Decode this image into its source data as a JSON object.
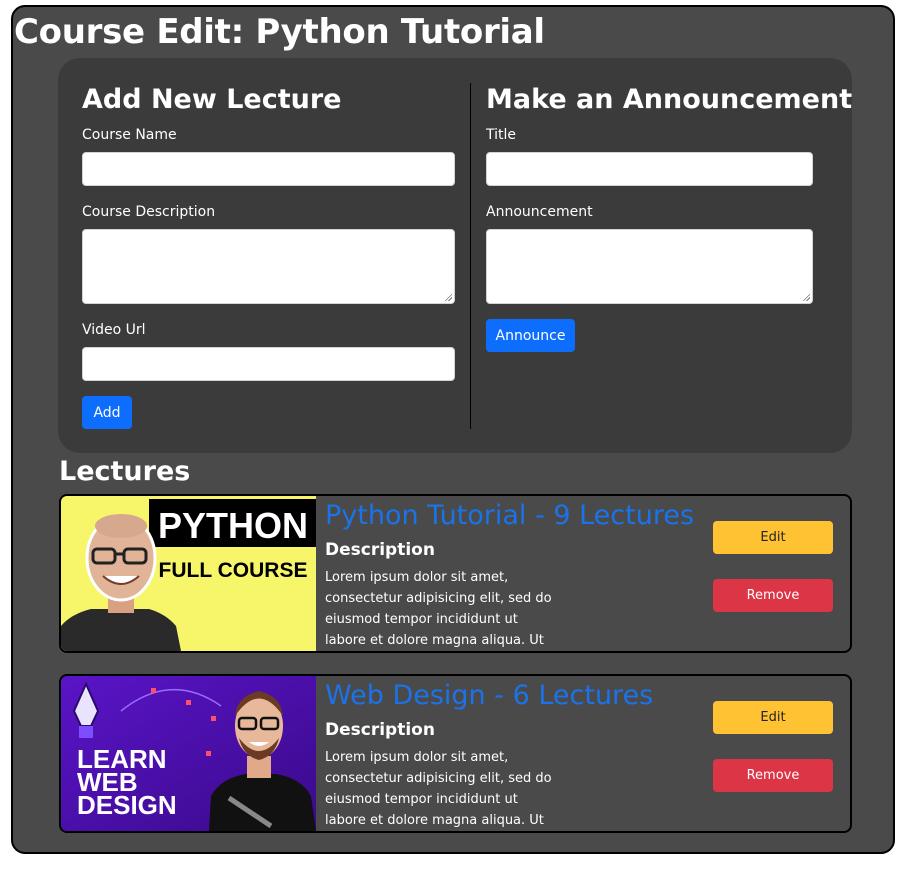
{
  "page": {
    "title": "Course Edit: Python Tutorial"
  },
  "lecture_form": {
    "heading": "Add New Lecture",
    "course_name_label": "Course Name",
    "course_name_value": "",
    "course_description_label": "Course Description",
    "course_description_value": "",
    "video_url_label": "Video Url",
    "video_url_value": "",
    "add_label": "Add"
  },
  "announcement_form": {
    "heading": "Make an Announcement",
    "title_label": "Title",
    "title_value": "",
    "announcement_label": "Announcement",
    "announcement_value": "",
    "announce_label": "Announce"
  },
  "lectures": {
    "heading": "Lectures",
    "items": [
      {
        "title": "Python Tutorial - 9 Lectures",
        "subtitle": "Description",
        "description": "Lorem ipsum dolor sit amet, consectetur adipisicing elit, sed do eiusmod tempor incididunt ut labore et dolore magna aliqua. Ut",
        "thumb_line1": "PYTHON",
        "thumb_line2": "FULL COURSE",
        "edit_label": "Edit",
        "remove_label": "Remove"
      },
      {
        "title": "Web Design - 6 Lectures",
        "subtitle": "Description",
        "description": "Lorem ipsum dolor sit amet, consectetur adipisicing elit, sed do eiusmod tempor incididunt ut labore et dolore magna aliqua. Ut",
        "thumb_line1": "LEARN",
        "thumb_line2": "WEB",
        "thumb_line3": "DESIGN",
        "edit_label": "Edit",
        "remove_label": "Remove"
      }
    ]
  },
  "colors": {
    "background": "#4a4a4a",
    "panel": "#3b3b3b",
    "primary": "#0d6efd",
    "link": "#1a73e8",
    "warning": "#ffc233",
    "danger": "#dc3545"
  }
}
